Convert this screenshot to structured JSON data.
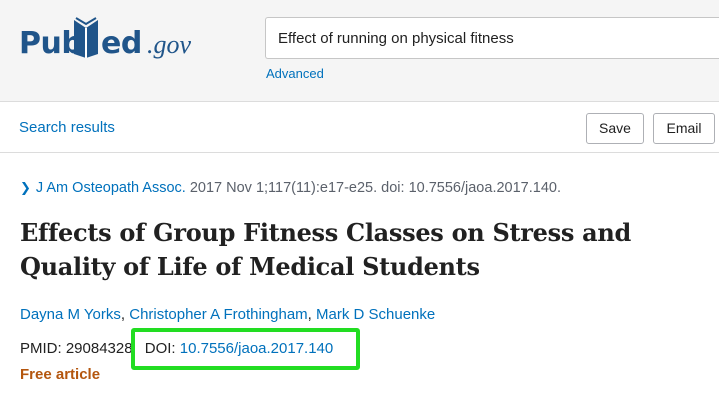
{
  "logo": {
    "pub": "Pub",
    "med": "ed",
    "gov": ".gov"
  },
  "search": {
    "value": "Effect of running on physical fitness"
  },
  "header": {
    "advanced_label": "Advanced"
  },
  "subbar": {
    "search_results_label": "Search results",
    "save_label": "Save",
    "email_label": "Email"
  },
  "article": {
    "journal": "J Am Osteopath Assoc.",
    "citation_rest": " 2017 Nov 1;117(11):e17-e25. doi: 10.7556/jaoa.2017.140.",
    "title": "Effects of Group Fitness Classes on Stress and Quality of Life of Medical Students",
    "authors": [
      "Dayna M Yorks",
      "Christopher A Frothingham",
      "Mark D Schuenke"
    ],
    "pmid_label": "PMID: 29084328",
    "doi_label": "DOI: ",
    "doi_value": "10.7556/jaoa.2017.140",
    "free_label": "Free article"
  },
  "colors": {
    "brand": "#20558a",
    "link": "#0071bc",
    "free": "#b4560e",
    "highlight": "#22dd22"
  },
  "icons": {
    "citation_chevron": "chevron-right-icon",
    "logo_book": "book-icon"
  }
}
